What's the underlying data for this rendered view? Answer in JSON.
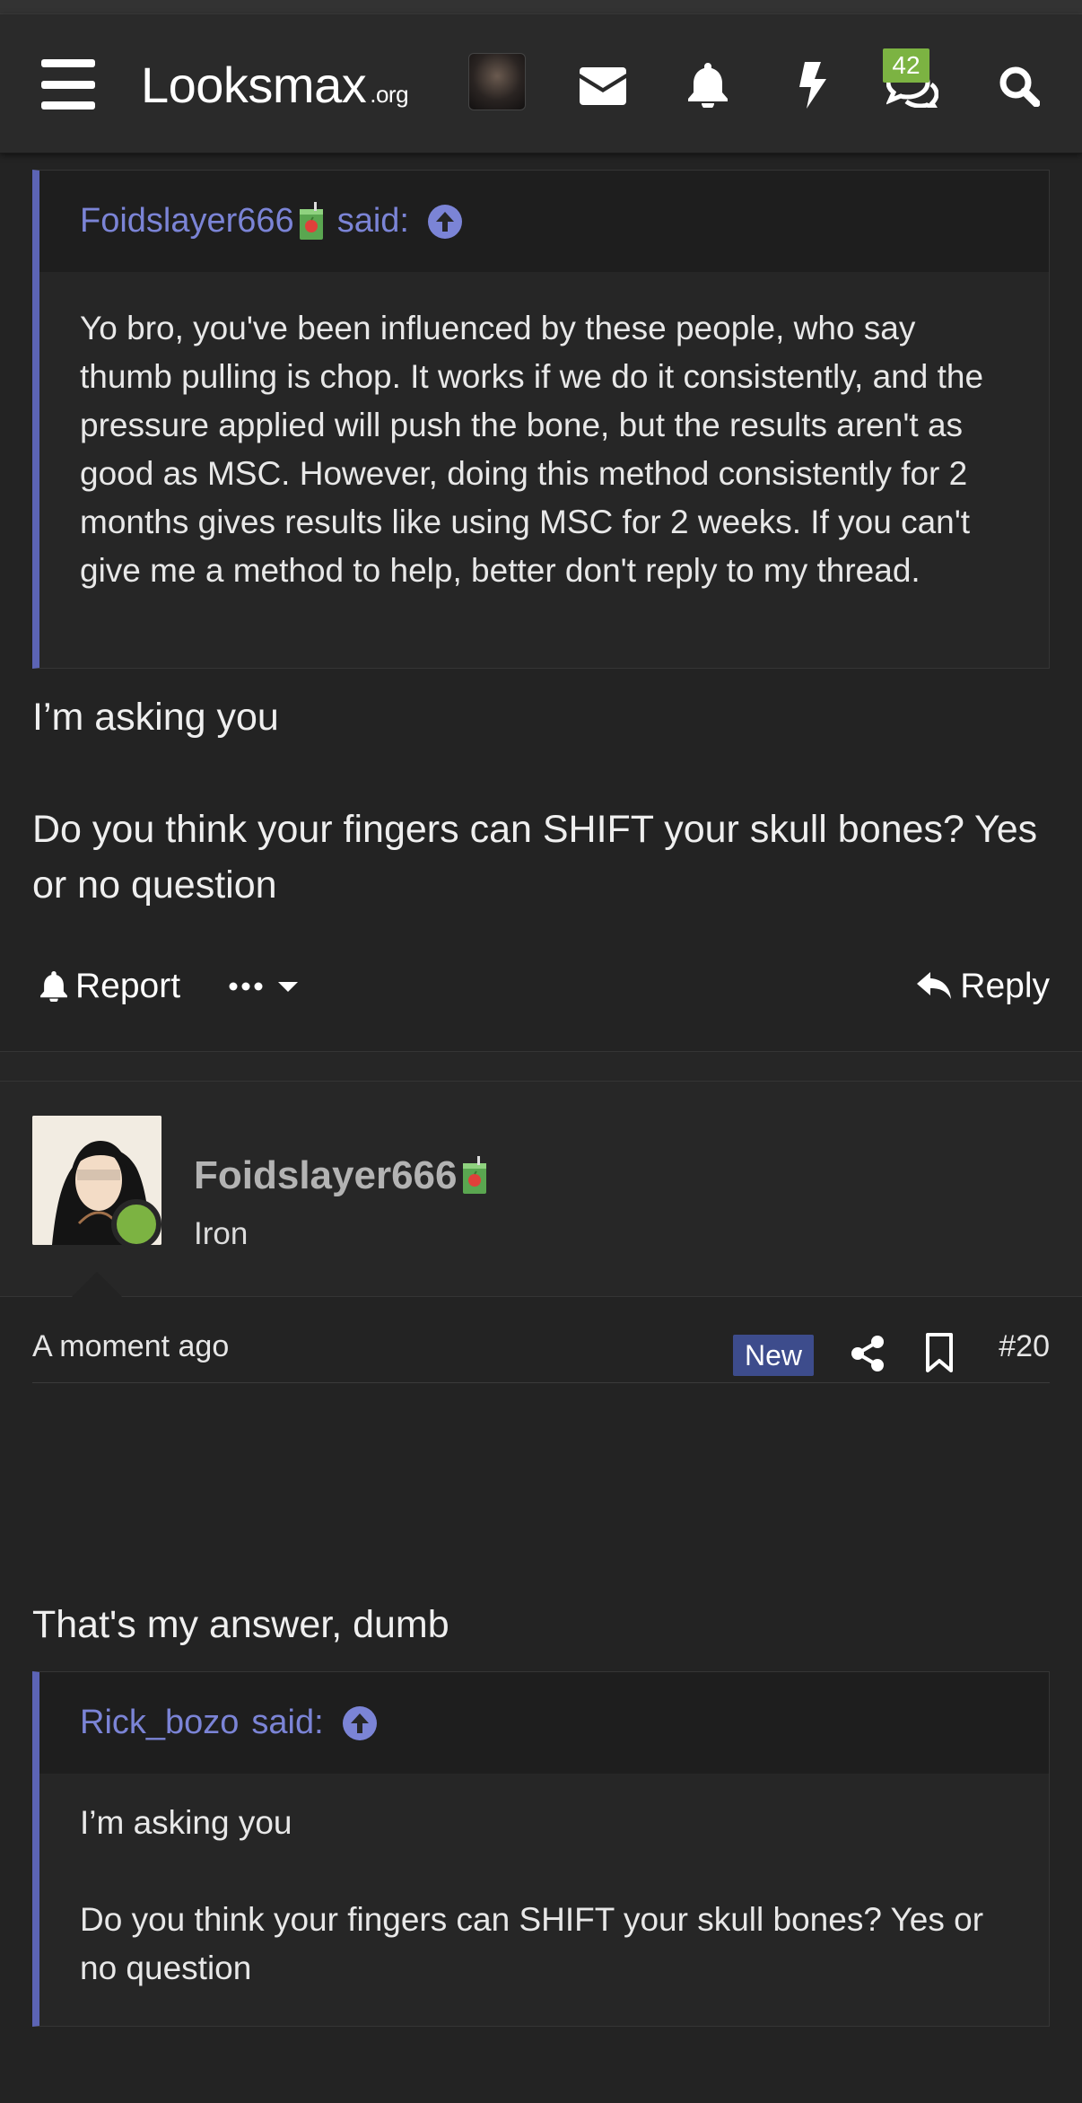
{
  "navbar": {
    "logo_main": "Looksmax",
    "logo_suffix": ".org",
    "chat_badge_count": "42",
    "icons": [
      "hamburger-icon",
      "envelope-icon",
      "bell-icon",
      "bolt-icon",
      "chat-icon",
      "search-icon"
    ]
  },
  "first_quote": {
    "author": "Foidslayer666",
    "said": "said:",
    "body": "Yo bro, you've been influenced by these people, who say thumb pulling is chop. It works if we do it consistently, and the pressure applied will push the bone, but the results aren't as good as MSC. However, doing this method consistently for 2 months gives results like using MSC for 2 weeks. If you can't give me a method to help, better don't reply to my thread."
  },
  "post1": {
    "line1": "I’m asking you",
    "line2": "Do you think your fingers can SHIFT your skull bones? Yes or no question",
    "report_label": "Report",
    "reply_label": "Reply"
  },
  "post2": {
    "username": "Foidslayer666",
    "user_title": "Iron",
    "time": "A moment ago",
    "new_label": "New",
    "post_number": "#20",
    "text": "That's my answer, dumb",
    "quote": {
      "author": "Rick_bozo",
      "said": "said:",
      "line1": "I’m asking you",
      "line2": "Do you think your fingers can SHIFT your skull bones? Yes or no question"
    }
  },
  "colors": {
    "background": "#232323",
    "quote_accent": "#5c64b5",
    "link": "#7b84d6",
    "online": "#7cb342",
    "new_badge": "#3d4c8c"
  }
}
